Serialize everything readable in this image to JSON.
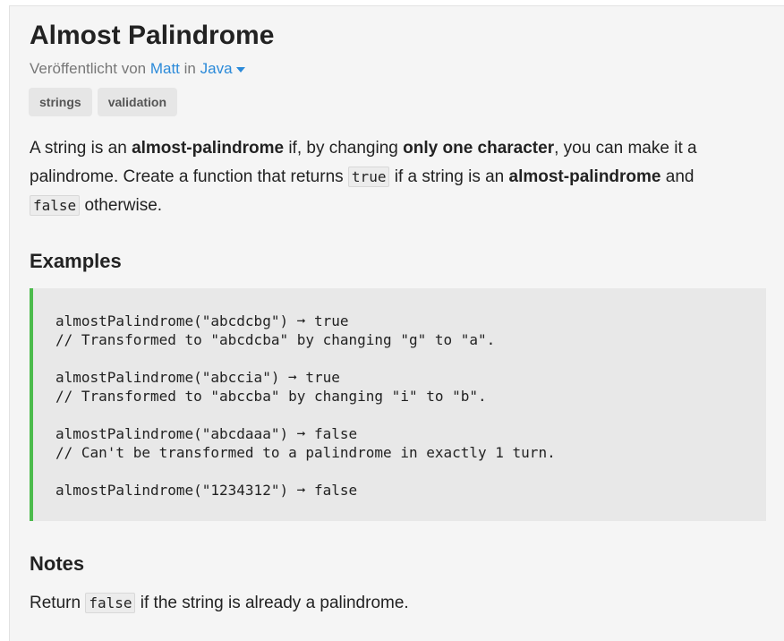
{
  "challenge": {
    "title": "Almost Palindrome",
    "byline": {
      "prefix": "Veröffentlicht von",
      "author": "Matt",
      "in_text": "in",
      "language": "Java"
    },
    "tags": [
      "strings",
      "validation"
    ]
  },
  "description": {
    "s1": "A string is an ",
    "b1": "almost-palindrome",
    "s2": " if, by changing ",
    "b2": "only one character",
    "s3": ", you can make it a palindrome. Create a function that returns ",
    "c1": "true",
    "s4": " if a string is an ",
    "b3": "almost-palindrome",
    "s5": " and ",
    "c2": "false",
    "s6": " otherwise."
  },
  "examples": {
    "heading": "Examples",
    "blocks": [
      [
        "almostPalindrome(\"abcdcbg\") ➞ true",
        "// Transformed to \"abcdcba\" by changing \"g\" to \"a\"."
      ],
      [
        "almostPalindrome(\"abccia\") ➞ true",
        "// Transformed to \"abccba\" by changing \"i\" to \"b\"."
      ],
      [
        "almostPalindrome(\"abcdaaa\") ➞ false",
        "// Can't be transformed to a palindrome in exactly 1 turn."
      ],
      [
        "almostPalindrome(\"1234312\") ➞ false"
      ]
    ]
  },
  "notes": {
    "heading": "Notes",
    "s1": "Return ",
    "c1": "false",
    "s2": " if the string is already a palindrome."
  }
}
